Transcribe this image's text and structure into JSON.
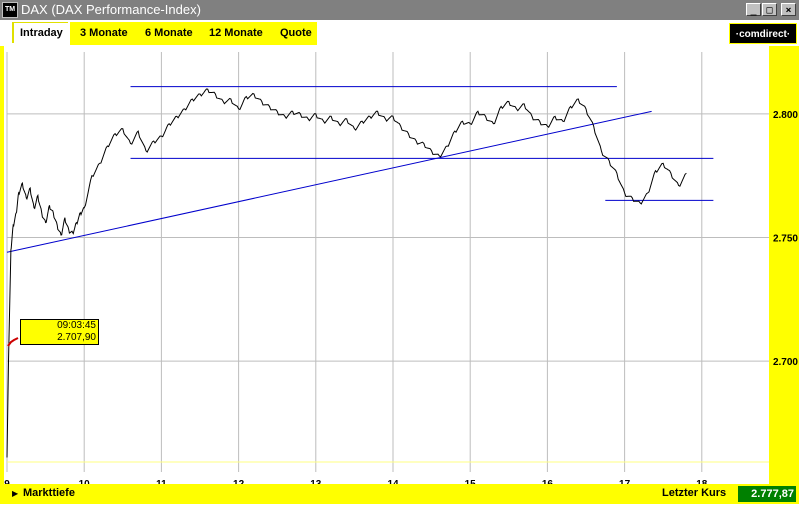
{
  "window": {
    "title": "DAX (DAX Performance-Index)",
    "icon_label": "TM",
    "buttons": [
      "_",
      "□",
      "×"
    ]
  },
  "toolbar": {
    "tabs": [
      {
        "label": "Intraday",
        "active": true
      },
      {
        "label": "3 Monate",
        "active": false
      },
      {
        "label": "6 Monate",
        "active": false
      },
      {
        "label": "12 Monate",
        "active": false
      },
      {
        "label": "Quote",
        "active": false
      }
    ],
    "logo": "·comdirect·"
  },
  "tooltip": {
    "time": "09:03:45",
    "value": "2.707,90"
  },
  "status": {
    "left_label": "Markttiefe",
    "right_label": "Letzter Kurs",
    "last_value": "2.777,87"
  },
  "colors": {
    "accent": "#ffff00",
    "trendline": "#0000cc",
    "price": "#000000",
    "last_value_bg": "#008000"
  },
  "chart_data": {
    "type": "line",
    "x_ticks": [
      "9",
      "10",
      "11",
      "12",
      "13",
      "14",
      "15",
      "16",
      "17",
      "18"
    ],
    "y_ticks": [
      "2.800",
      "2.750",
      "2.700"
    ],
    "ylim": [
      2660,
      2825
    ],
    "xlim": [
      9.0,
      18.3
    ],
    "grid": true,
    "series": [
      {
        "x": [
          9.0,
          9.02,
          9.05,
          9.08,
          9.12,
          9.15,
          9.2,
          9.25,
          9.3,
          9.35,
          9.4,
          9.45,
          9.5,
          9.55,
          9.6,
          9.65,
          9.7,
          9.75,
          9.8,
          9.85,
          9.9,
          9.95,
          10.0,
          10.1,
          10.2,
          10.3,
          10.4,
          10.5,
          10.6,
          10.7,
          10.8,
          10.9,
          11.0,
          11.1,
          11.2,
          11.3,
          11.4,
          11.5,
          11.6,
          11.7,
          11.8,
          11.9,
          12.0,
          12.1,
          12.2,
          12.3,
          12.4,
          12.5,
          12.6,
          12.7,
          12.8,
          12.9,
          13.0,
          13.1,
          13.2,
          13.3,
          13.4,
          13.5,
          13.6,
          13.7,
          13.8,
          13.9,
          14.0,
          14.1,
          14.2,
          14.3,
          14.4,
          14.5,
          14.6,
          14.7,
          14.8,
          14.9,
          15.0,
          15.1,
          15.2,
          15.3,
          15.4,
          15.5,
          15.6,
          15.7,
          15.8,
          15.9,
          16.0,
          16.1,
          16.2,
          16.3,
          16.4,
          16.5,
          16.6,
          16.7,
          16.8,
          16.9,
          17.0,
          17.1,
          17.2,
          17.3,
          17.4,
          17.5,
          17.6,
          17.7,
          17.8
        ],
        "y": [
          2661,
          2700,
          2745,
          2755,
          2760,
          2768,
          2772,
          2766,
          2770,
          2762,
          2767,
          2760,
          2756,
          2763,
          2760,
          2755,
          2751,
          2758,
          2753,
          2752,
          2756,
          2760,
          2762,
          2775,
          2780,
          2787,
          2792,
          2794,
          2788,
          2793,
          2785,
          2789,
          2791,
          2796,
          2799,
          2802,
          2806,
          2808,
          2810,
          2808,
          2805,
          2806,
          2802,
          2807,
          2808,
          2805,
          2803,
          2801,
          2799,
          2801,
          2800,
          2798,
          2800,
          2797,
          2799,
          2796,
          2798,
          2794,
          2797,
          2799,
          2801,
          2798,
          2799,
          2795,
          2792,
          2789,
          2788,
          2785,
          2783,
          2787,
          2793,
          2797,
          2796,
          2801,
          2799,
          2796,
          2803,
          2805,
          2802,
          2804,
          2799,
          2797,
          2795,
          2799,
          2797,
          2803,
          2806,
          2802,
          2795,
          2785,
          2781,
          2776,
          2768,
          2766,
          2764,
          2768,
          2777,
          2780,
          2776,
          2771,
          2776
        ]
      }
    ],
    "trendlines": [
      {
        "x": [
          9.0,
          17.35
        ],
        "y": [
          2744,
          2801
        ]
      },
      {
        "x": [
          10.6,
          16.9
        ],
        "y": [
          2811,
          2811
        ]
      },
      {
        "x": [
          10.6,
          18.15
        ],
        "y": [
          2782,
          2782
        ]
      },
      {
        "x": [
          16.75,
          18.15
        ],
        "y": [
          2765,
          2765
        ]
      },
      {
        "x": [
          9.0,
          18.3
        ],
        "y": [
          2660,
          2660
        ]
      }
    ]
  }
}
